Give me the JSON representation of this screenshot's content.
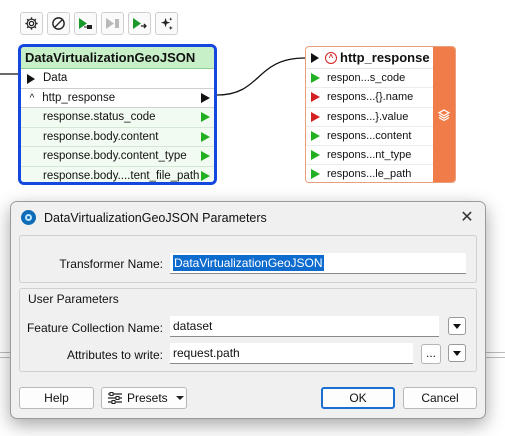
{
  "toolbar": {
    "buttons": [
      "gear-icon",
      "disable-icon",
      "run-to-this-icon",
      "run-from-this-icon",
      "run-this-only-icon",
      "sparkle-icon"
    ]
  },
  "transformer": {
    "title": "DataVirtualizationGeoJSON",
    "input_port": "Data",
    "group_label": "http_response",
    "attributes": [
      "response.status_code",
      "response.body.content",
      "response.body.content_type",
      "response.body....tent_file_path"
    ]
  },
  "bookmark": {
    "title": "http_response",
    "rows": [
      {
        "label": "respon...s_code",
        "port": "green"
      },
      {
        "label": "respons...{}.name",
        "port": "red"
      },
      {
        "label": "respons...}.value",
        "port": "red"
      },
      {
        "label": "respons...content",
        "port": "green"
      },
      {
        "label": "respons...nt_type",
        "port": "green"
      },
      {
        "label": "respons...le_path",
        "port": "green"
      }
    ],
    "side_icon": "layers-icon"
  },
  "dialog": {
    "title": "DataVirtualizationGeoJSON Parameters",
    "transformer_name_label": "Transformer Name:",
    "transformer_name_value": "DataVirtualizationGeoJSON",
    "user_parameters_label": "User Parameters",
    "feature_collection_label": "Feature Collection Name:",
    "feature_collection_value": "dataset",
    "attributes_label": "Attributes to write:",
    "attributes_value": "request.path",
    "ellipsis_label": "...",
    "buttons": {
      "help": "Help",
      "presets": "Presets",
      "ok": "OK",
      "cancel": "Cancel"
    }
  },
  "colors": {
    "transformer_border": "#1447e0",
    "transformer_header": "#c8f0c8",
    "bookmark_accent": "#f07c4a",
    "port_green": "#22b022",
    "port_red": "#d42020",
    "selection": "#0f6ccf"
  }
}
